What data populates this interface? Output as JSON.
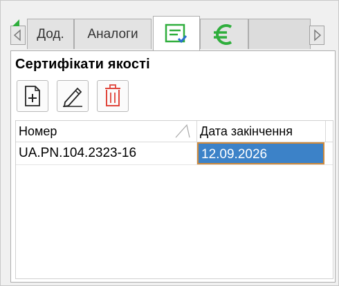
{
  "tabs": [
    {
      "label": "Дод.",
      "active": false
    },
    {
      "label": "Аналоги",
      "active": false
    },
    {
      "label": "",
      "icon": "certificate-check-icon",
      "active": true
    },
    {
      "label": "",
      "icon": "euro-icon",
      "active": false
    }
  ],
  "panel": {
    "title": "Сертифікати якості"
  },
  "toolbar": {
    "buttons": [
      {
        "icon": "add-document-icon"
      },
      {
        "icon": "edit-pencil-icon"
      },
      {
        "icon": "delete-trash-icon"
      }
    ]
  },
  "grid": {
    "columns": [
      "Номер",
      "Дата закінчення"
    ],
    "rows": [
      [
        "UA.PN.104.2323-16",
        "12.09.2026"
      ]
    ]
  },
  "colors": {
    "accent_green": "#2fae3c",
    "selection_blue": "#3c82c8",
    "delete_red": "#e0443a",
    "focus_border": "#d08a3a"
  }
}
